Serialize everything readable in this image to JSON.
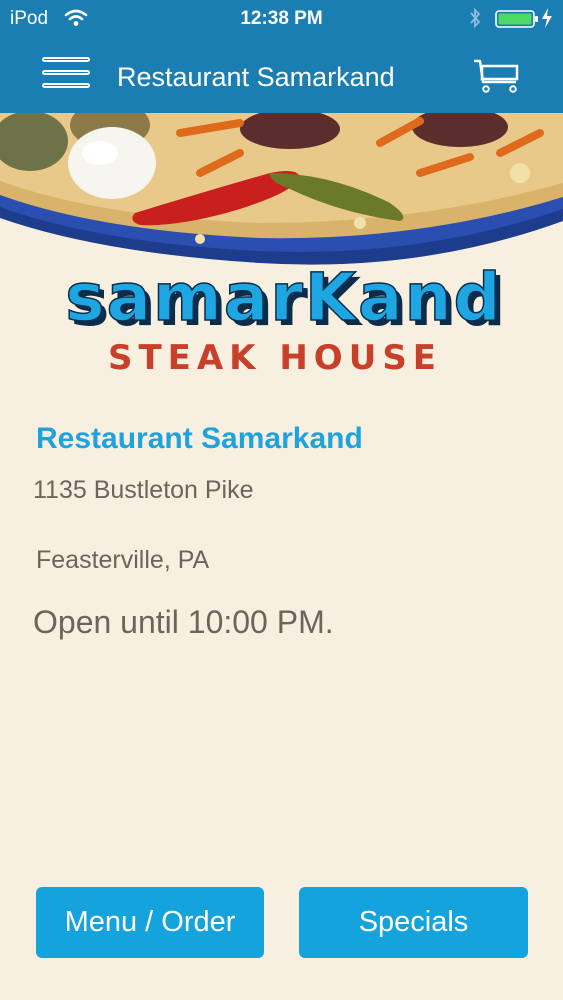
{
  "status": {
    "device": "iPod",
    "time": "12:38 PM"
  },
  "navbar": {
    "title": "Restaurant Samarkand",
    "menu_icon": "hamburger-icon",
    "cart_icon": "cart-icon"
  },
  "logo": {
    "brand": "samarKand",
    "tagline": "STEAK HOUSE"
  },
  "restaurant": {
    "name": "Restaurant Samarkand",
    "address": "1135 Bustleton Pike",
    "city": "Feasterville, PA",
    "hours": "Open until 10:00 PM."
  },
  "buttons": {
    "menu_order": "Menu / Order",
    "specials": "Specials"
  },
  "colors": {
    "header": "#1b7eb2",
    "accent": "#1ea3df",
    "button": "#14a3dd",
    "background": "#f7f0e1",
    "logo_red": "#c8402a"
  }
}
